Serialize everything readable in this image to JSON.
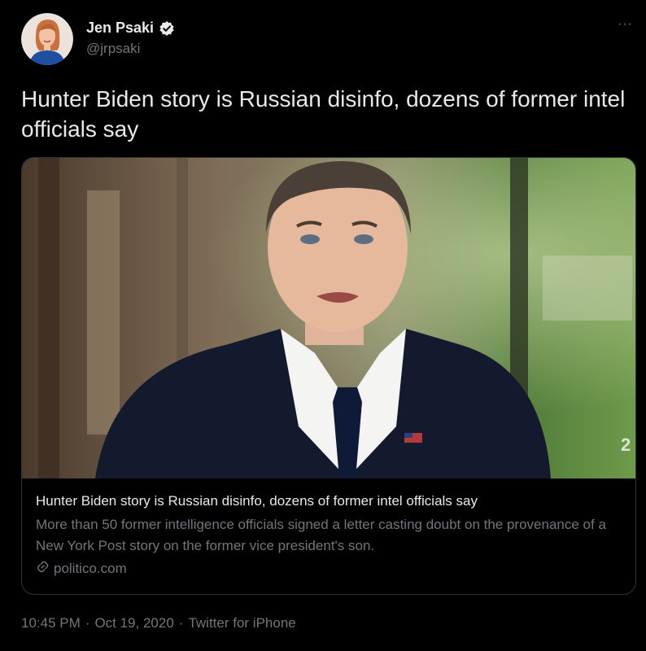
{
  "author": {
    "name": "Jen Psaki",
    "handle": "@jrpsaki",
    "verified_icon": "verified-badge-icon"
  },
  "more_icon": "more-options-icon",
  "tweet": {
    "text": "Hunter Biden story is Russian disinfo, dozens of former intel officials say"
  },
  "card": {
    "title": "Hunter Biden story is Russian disinfo, dozens of former intel officials say",
    "description": "More than 50 former intelligence officials signed a letter casting doubt on the provenance of a New York Post story on the former vice president's son.",
    "domain": "politico.com",
    "domain_icon": "link-icon",
    "image_watermark": "2"
  },
  "meta": {
    "time": "10:45 PM",
    "separator": "·",
    "date": "Oct 19, 2020",
    "source": "Twitter for iPhone"
  },
  "colors": {
    "background": "#000000",
    "primary_text": "#e7e9ea",
    "secondary_text": "#71767b",
    "border": "#2f3336"
  }
}
